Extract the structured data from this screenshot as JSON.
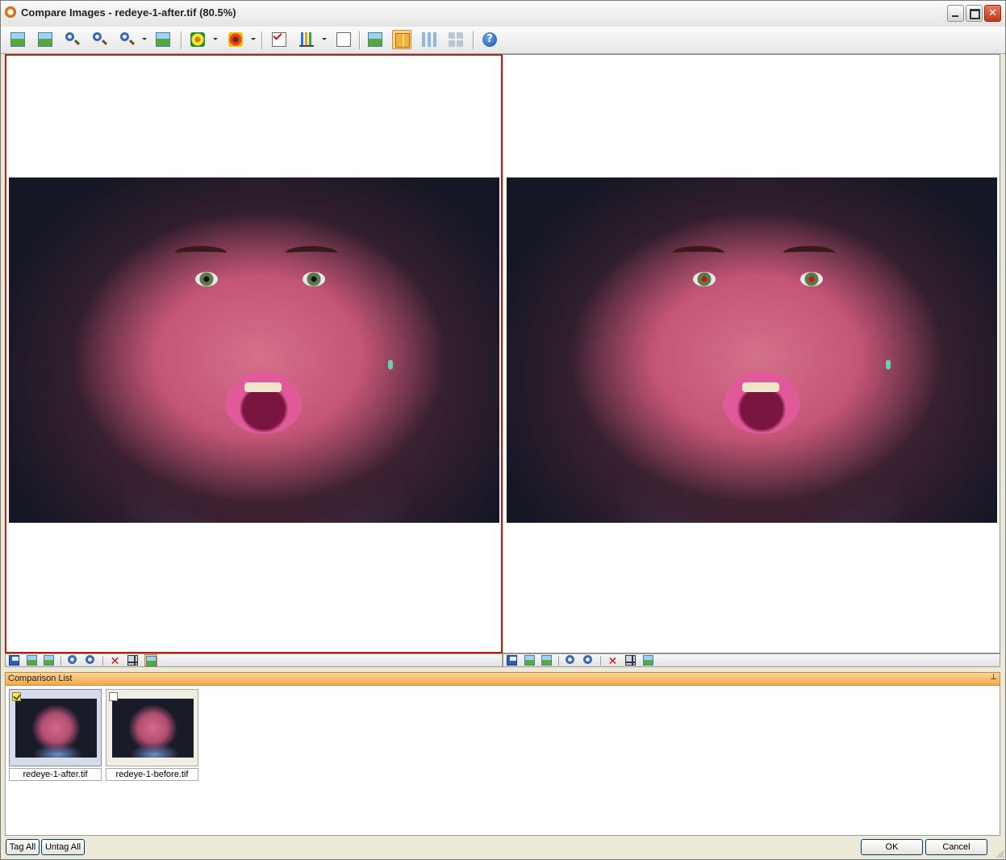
{
  "window": {
    "title": "Compare Images - redeye-1-after.tif (80.5%)",
    "minimize_label": "",
    "maximize_label": "",
    "close_label": ""
  },
  "toolbar": {
    "icons": [
      "add-image-icon",
      "replace-image-icon",
      "zoom-in-icon",
      "zoom-out-icon",
      "zoom-dropdown-icon",
      "fit-image-icon",
      "enhance-icon",
      "red-eye-icon",
      "tag-icon",
      "histogram-icon",
      "properties-icon",
      "single-view-icon",
      "two-up-view-icon",
      "three-up-view-icon",
      "four-up-view-icon",
      "help-icon"
    ],
    "active_view": "two-up-view",
    "help_glyph": "?"
  },
  "panes": [
    {
      "name": "left",
      "selected": true,
      "red_eye": false
    },
    {
      "name": "right",
      "selected": false,
      "red_eye": true
    }
  ],
  "pane_toolbar": {
    "icons": [
      "save-icon",
      "open-icon",
      "replace-icon",
      "zoom-in-icon",
      "zoom-out-icon",
      "close-icon",
      "grid-icon",
      "overlay-icon"
    ],
    "close_glyph": "✕"
  },
  "comparison_list": {
    "title": "Comparison List",
    "pin_glyph": "⊥",
    "items": [
      {
        "label": "redeye-1-after.tif",
        "checked": true,
        "selected": true
      },
      {
        "label": "redeye-1-before.tif",
        "checked": false,
        "selected": false
      }
    ]
  },
  "buttons": {
    "tag_all": "Tag All",
    "untag_all": "Untag All",
    "ok": "OK",
    "cancel": "Cancel"
  },
  "colors": {
    "selected_pane_border": "#b0221a",
    "list_header": "#f4a94a",
    "active_tool": "#f8d48a"
  }
}
